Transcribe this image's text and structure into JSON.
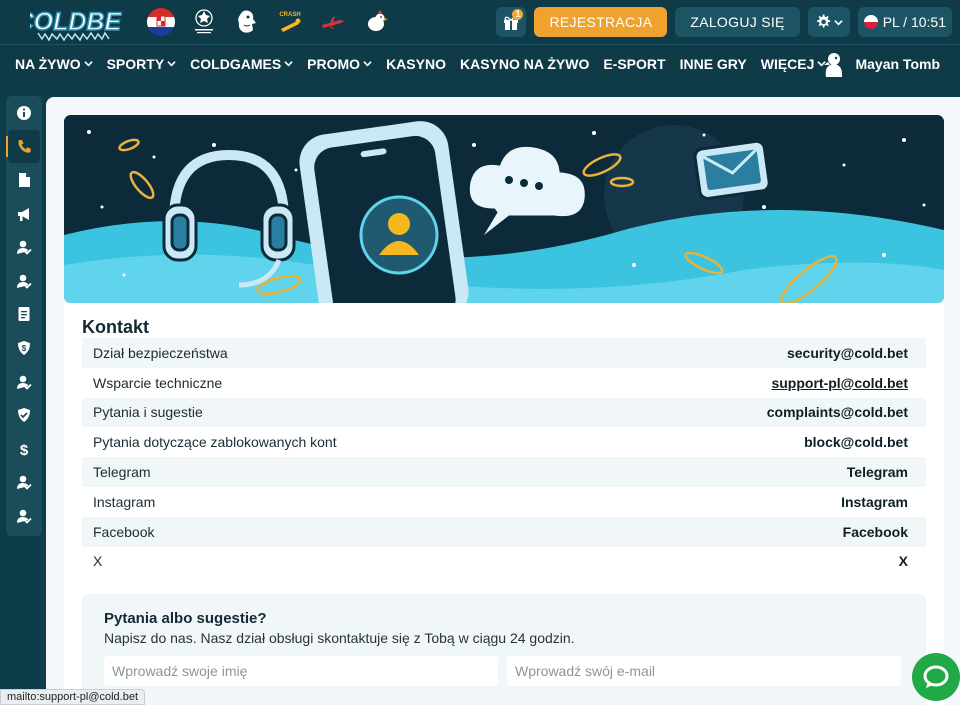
{
  "header": {
    "logo_text": "COLDBET",
    "top_icons": [
      "croatia-flag-icon",
      "champions-league-icon",
      "premier-league-icon",
      "crash-game-icon",
      "plane-game-icon",
      "chicken-game-icon"
    ],
    "gift_badge": "1",
    "register_label": "REJESTRACJA",
    "login_label": "ZALOGUJ SIĘ",
    "lang_label": "PL / 10:51"
  },
  "nav": {
    "items": [
      {
        "label": "NA ŻYWO",
        "dropdown": true
      },
      {
        "label": "SPORTY",
        "dropdown": true
      },
      {
        "label": "COLDGAMES",
        "dropdown": true
      },
      {
        "label": "PROMO",
        "dropdown": true
      },
      {
        "label": "KASYNO",
        "dropdown": false
      },
      {
        "label": "KASYNO NA ŻYWO",
        "dropdown": false
      },
      {
        "label": "E-SPORT",
        "dropdown": false
      },
      {
        "label": "INNE GRY",
        "dropdown": false
      },
      {
        "label": "WIĘCEJ",
        "dropdown": true
      }
    ],
    "featured": "Mayan Tomb"
  },
  "sidebar": {
    "items": [
      "info-icon",
      "phone-icon",
      "document-icon",
      "megaphone-icon",
      "user-check-icon",
      "user-check-icon",
      "file-text-icon",
      "shield-dollar-icon",
      "user-check-icon",
      "shield-check-icon",
      "dollar-icon",
      "user-check-icon",
      "user-check-icon"
    ],
    "active_index": 1
  },
  "contact": {
    "title": "Kontakt",
    "rows": [
      {
        "label": "Dział bezpieczeństwa",
        "value": "security@cold.bet"
      },
      {
        "label": "Wsparcie techniczne",
        "value": "support-pl@cold.bet"
      },
      {
        "label": "Pytania i sugestie",
        "value": "complaints@cold.bet"
      },
      {
        "label": "Pytania dotyczące zablokowanych kont",
        "value": "block@cold.bet"
      },
      {
        "label": "Telegram",
        "value": "Telegram"
      },
      {
        "label": "Instagram",
        "value": "Instagram"
      },
      {
        "label": "Facebook",
        "value": "Facebook"
      },
      {
        "label": "X",
        "value": "X"
      }
    ]
  },
  "form": {
    "title": "Pytania albo sugestie?",
    "subtitle": "Napisz do nas. Nasz dział obsługi skontaktuje się z Tobą w ciągu 24 godzin.",
    "name_placeholder": "Wprowadź swoje imię",
    "email_placeholder": "Wprowadź swój e-mail"
  },
  "status_bar": "mailto:support-pl@cold.bet",
  "colors": {
    "accent": "#f0a22e",
    "header_bg": "#0f3a48",
    "chat_green": "#20a946"
  }
}
